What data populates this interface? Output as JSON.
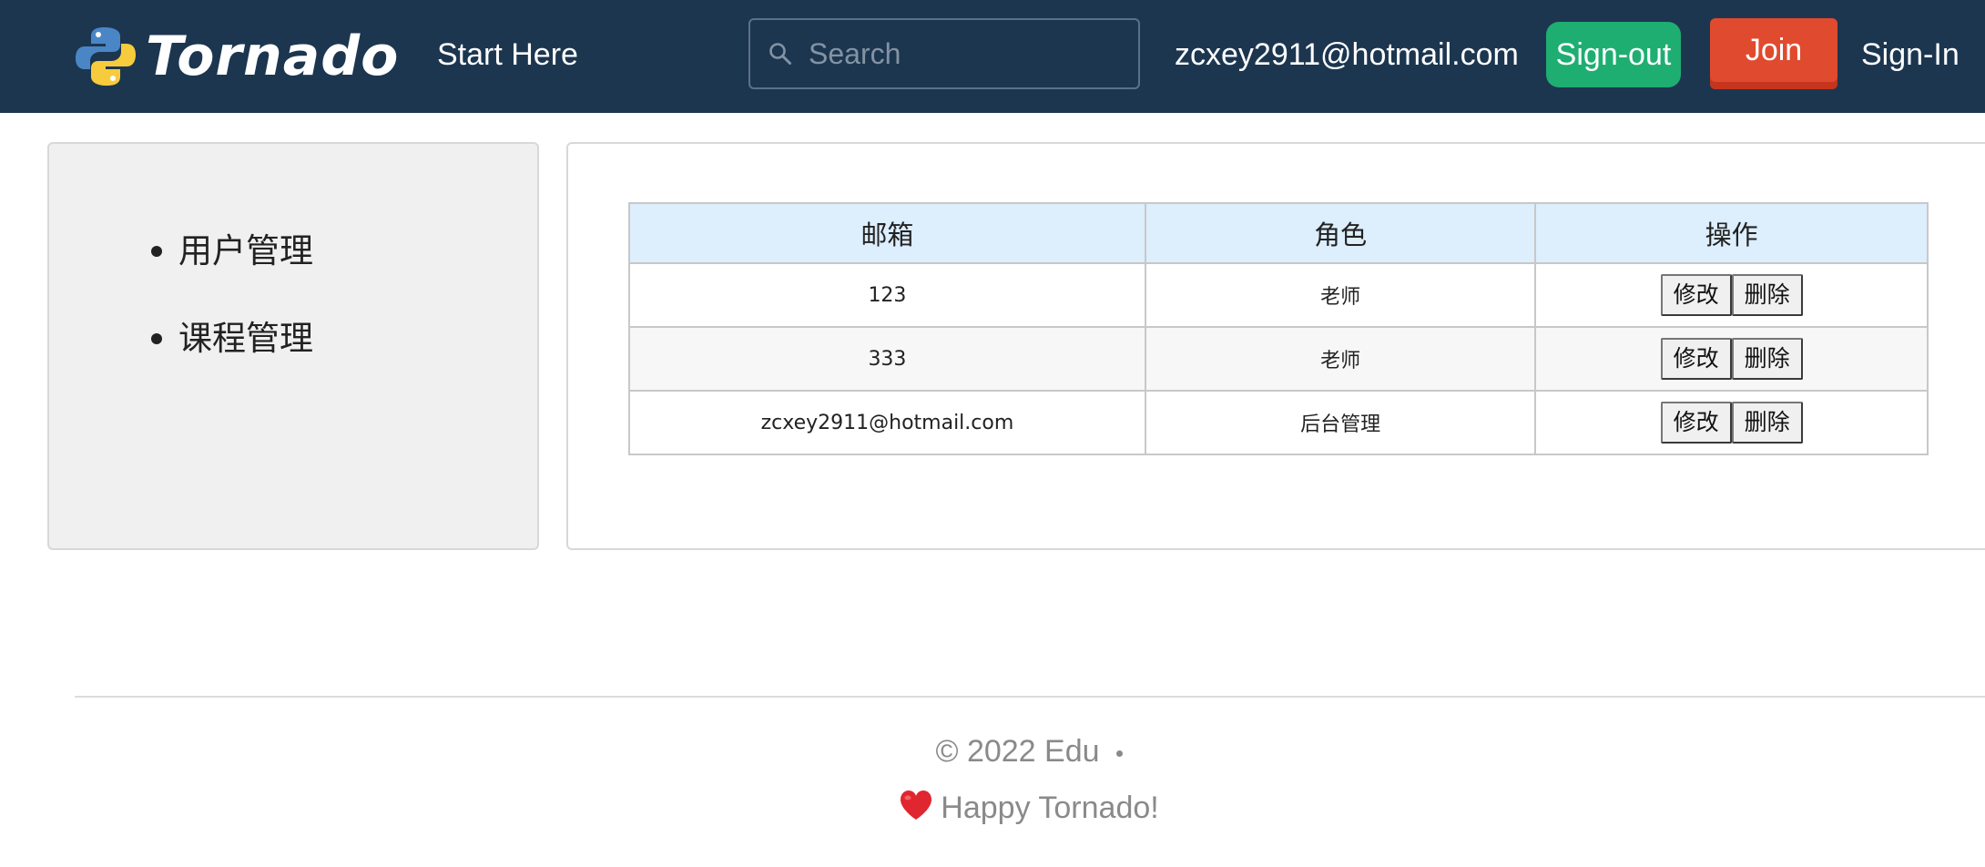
{
  "header": {
    "brand": "Tornado",
    "start_here": "Start Here",
    "search_placeholder": "Search",
    "search_value": "",
    "user_email": "zcxey2911@hotmail.com",
    "sign_out_label": "Sign-out",
    "join_label": "Join",
    "sign_in_label": "Sign-In"
  },
  "sidebar": {
    "items": [
      {
        "label": "用户管理"
      },
      {
        "label": "课程管理"
      }
    ]
  },
  "table": {
    "headers": [
      "邮箱",
      "角色",
      "操作"
    ],
    "rows": [
      {
        "email": "123",
        "role": "老师",
        "edit_label": "修改",
        "delete_label": "删除"
      },
      {
        "email": "333",
        "role": "老师",
        "edit_label": "修改",
        "delete_label": "删除"
      },
      {
        "email": "zcxey2911@hotmail.com",
        "role": "后台管理",
        "edit_label": "修改",
        "delete_label": "删除"
      }
    ]
  },
  "footer": {
    "copyright": "© 2022 Edu",
    "tagline": "Happy Tornado!"
  },
  "colors": {
    "navbar_bg": "#1c3650",
    "sign_out_green": "#1fae72",
    "join_red": "#e04a2e",
    "table_header_bg": "#ddeefd",
    "sidebar_bg": "#f0f0f0"
  },
  "icons": {
    "brand_logo": "python-logo-icon",
    "search": "search-icon",
    "heart": "heart-icon"
  }
}
